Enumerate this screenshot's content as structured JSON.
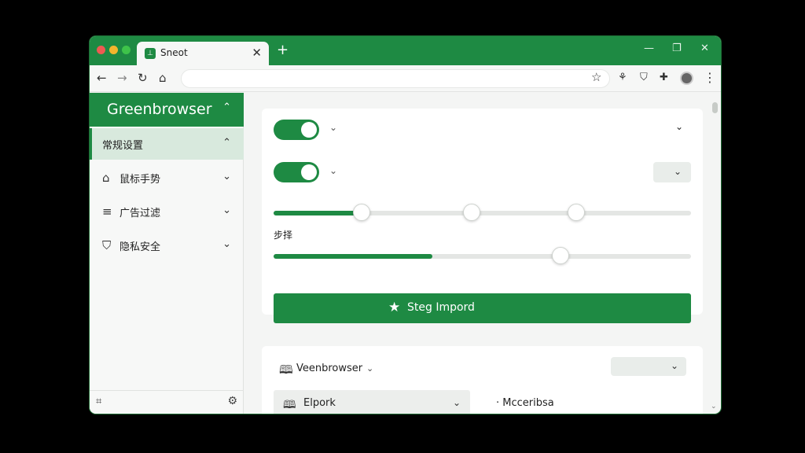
{
  "tab": {
    "title": "Sneot",
    "favicon": "⊥",
    "close": "✕"
  },
  "titlebar": {
    "new_tab": "+",
    "minimize": "—",
    "maximize": "❐",
    "close": "✕"
  },
  "toolbar": {
    "back": "←",
    "forward": "→",
    "reload": "↻",
    "home": "⌂",
    "bookmark": "☆",
    "ext1": "⚘",
    "ext2": "⛉",
    "ext3": "✚",
    "menu": "⋮"
  },
  "sidebar": {
    "title": "Greenbrowser",
    "head_chevron": "⌃",
    "items": [
      {
        "label": "常规设置",
        "icon": "",
        "chevron": "⌃"
      },
      {
        "label": "鼠标手势",
        "icon": "⌂",
        "chevron": "⌄"
      },
      {
        "label": "广告过滤",
        "icon": "≡",
        "chevron": "⌄"
      },
      {
        "label": "隐私安全",
        "icon": "⛉",
        "chevron": "⌄"
      }
    ],
    "footer_left": "⌗",
    "footer_right": "⚙"
  },
  "card1": {
    "chevron": "⌄",
    "slider2_label": "步择",
    "slider1_value": 0.21,
    "slider2_value": 0.38,
    "import_label": "Steg Impord",
    "import_icon": "★"
  },
  "card2": {
    "dropdown_label": "Veenbrowser",
    "chevron": "⌄",
    "select_label": "Elpork",
    "select_icon": "🕮",
    "side_text": "· Mcceribsa"
  },
  "colors": {
    "accent": "#1e8a43",
    "active_bg": "#d8e9dd"
  },
  "icons": [
    "menu-dots-icon",
    "star-icon",
    "home-icon",
    "reload-icon",
    "gear-icon",
    "book-icon"
  ]
}
